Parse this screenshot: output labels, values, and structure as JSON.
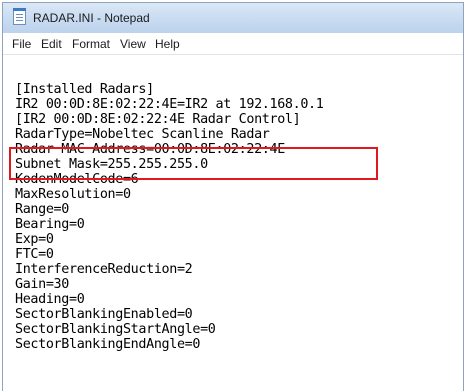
{
  "window": {
    "title": "RADAR.INI - Notepad"
  },
  "menu": {
    "items": [
      "File",
      "Edit",
      "Format",
      "View",
      "Help"
    ]
  },
  "editor": {
    "lines": [
      "[Installed Radars]",
      "IR2 00:0D:8E:02:22:4E=IR2 at 192.168.0.1",
      "[IR2 00:0D:8E:02:22:4E Radar Control]",
      "RadarType=Nobeltec Scanline Radar",
      "Radar MAC Address=00:0D:8E:02:22:4E",
      "Subnet Mask=255.255.255.0",
      "KodenModelCode=6",
      "MaxResolution=0",
      "Range=0",
      "Bearing=0",
      "Exp=0",
      "FTC=0",
      "InterferenceReduction=2",
      "Gain=30",
      "Heading=0",
      "SectorBlankingEnabled=0",
      "SectorBlankingStartAngle=0",
      "SectorBlankingEndAngle=0"
    ]
  },
  "highlight": {
    "color": "#e0191f",
    "lines_highlighted": [
      5,
      6
    ]
  }
}
